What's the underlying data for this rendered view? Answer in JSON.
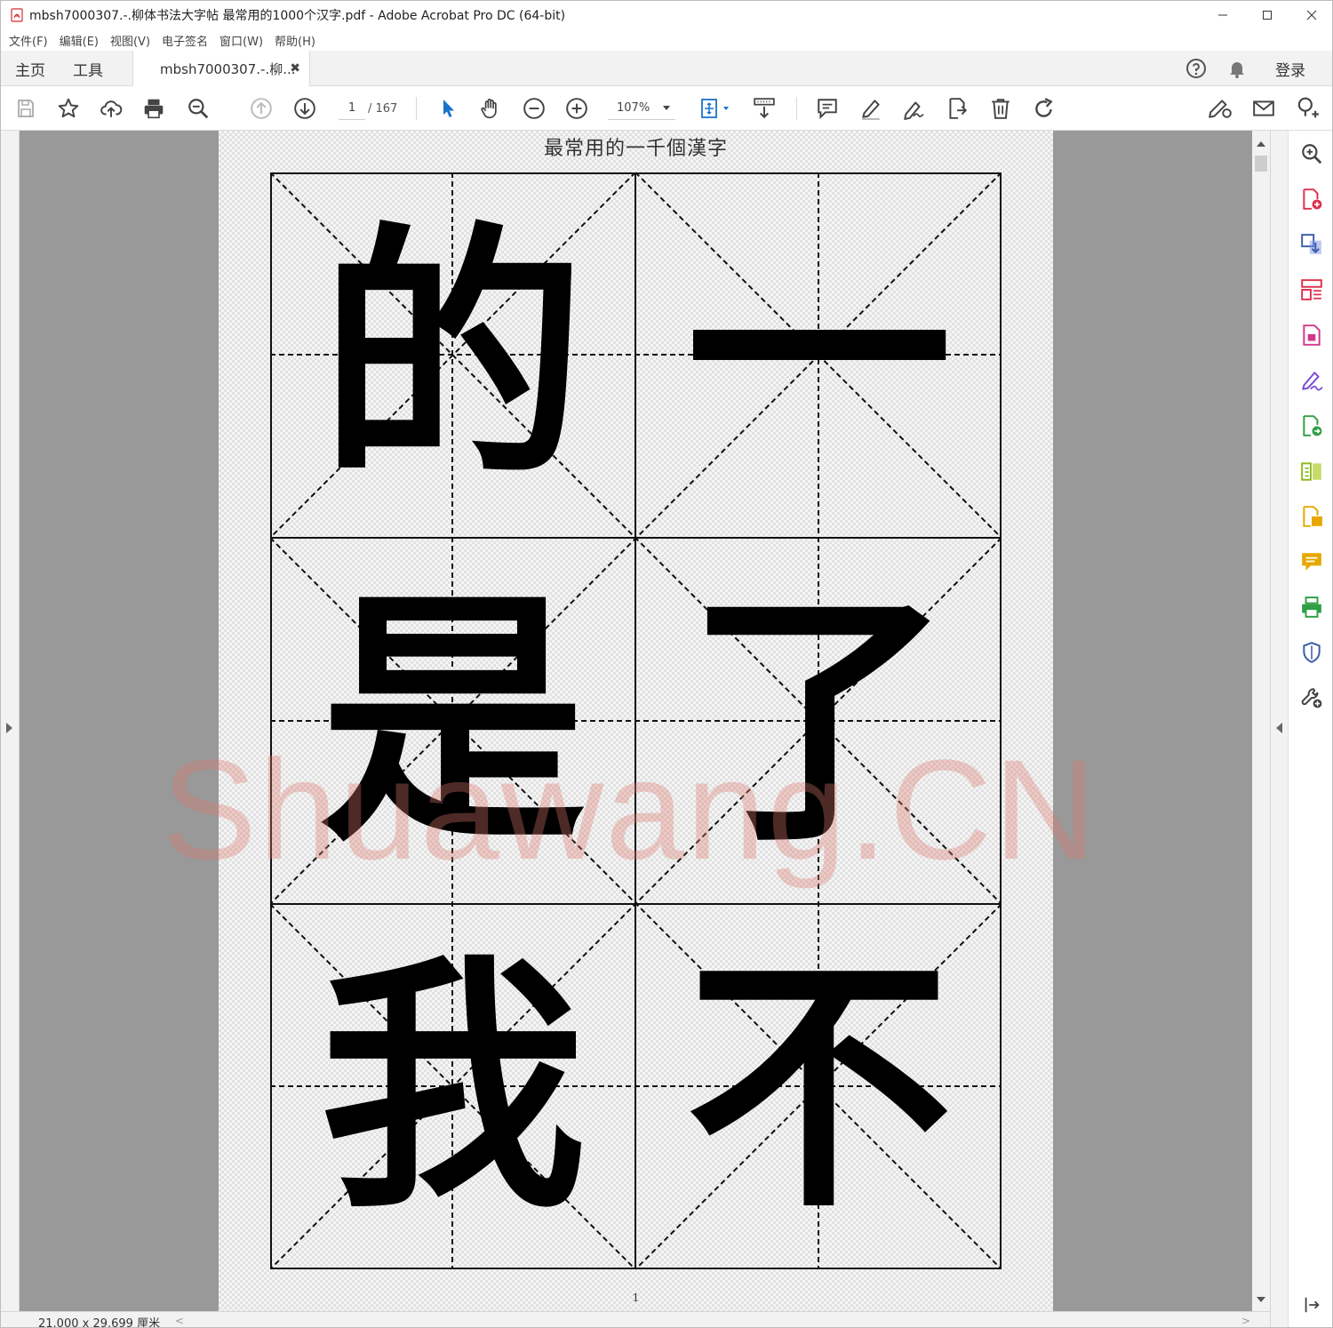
{
  "window": {
    "title": "mbsh7000307.-.柳体书法大字帖 最常用的1000个汉字.pdf - Adobe Acrobat Pro DC (64-bit)",
    "minimize_icon": "minimize-icon",
    "maximize_icon": "maximize-icon",
    "close_icon": "close-icon"
  },
  "menu": [
    "文件(F)",
    "编辑(E)",
    "视图(V)",
    "电子签名",
    "窗口(W)",
    "帮助(H)"
  ],
  "tabs": {
    "home": "主页",
    "tools": "工具",
    "document": "mbsh7000307.-.柳...",
    "document_close": "✖",
    "login": "登录"
  },
  "toolbar": {
    "current_page": "1",
    "total_pages": "/ 167",
    "zoom": "107%"
  },
  "document": {
    "heading": "最常用的一千個漢字",
    "page_number": "1",
    "characters": [
      "的",
      "一",
      "是",
      "了",
      "我",
      "不"
    ],
    "watermark": "Shuawang.CN"
  },
  "status": {
    "dimensions": "21.000 x 29.699 厘米",
    "scroll_left": "<",
    "scroll_right": ">"
  },
  "colors": {
    "accent_blue": "#1a73c8",
    "tool_red": "#e0304e",
    "tool_purple": "#7b4bd6",
    "tool_magenta": "#d0388a",
    "tool_green": "#2f9e44",
    "tool_yellow": "#e6a800",
    "tool_navy": "#3a5da8"
  }
}
